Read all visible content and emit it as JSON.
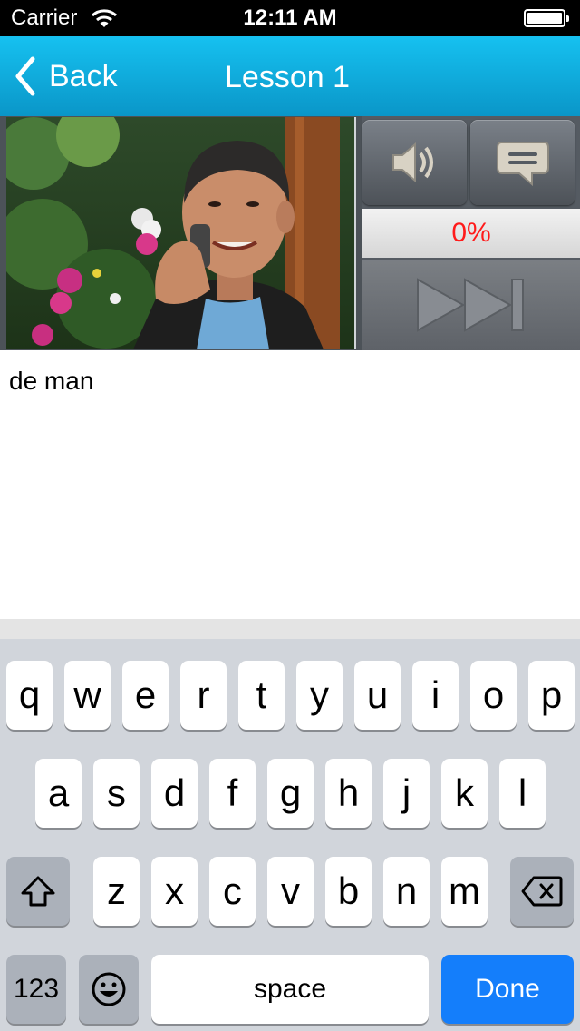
{
  "status_bar": {
    "carrier": "Carrier",
    "time": "12:11 AM"
  },
  "nav": {
    "back_label": "Back",
    "title": "Lesson 1"
  },
  "player": {
    "progress": "0%",
    "progress_color": "#ff1a1a"
  },
  "answer": {
    "text": "de man"
  },
  "keyboard": {
    "row1": [
      "q",
      "w",
      "e",
      "r",
      "t",
      "y",
      "u",
      "i",
      "o",
      "p"
    ],
    "row2": [
      "a",
      "s",
      "d",
      "f",
      "g",
      "h",
      "j",
      "k",
      "l"
    ],
    "row3": [
      "z",
      "x",
      "c",
      "v",
      "b",
      "n",
      "m"
    ],
    "numbers_label": "123",
    "space_label": "space",
    "done_label": "Done",
    "done_color": "#147efb"
  },
  "colors": {
    "nav_accent": "#0ea9dc"
  }
}
